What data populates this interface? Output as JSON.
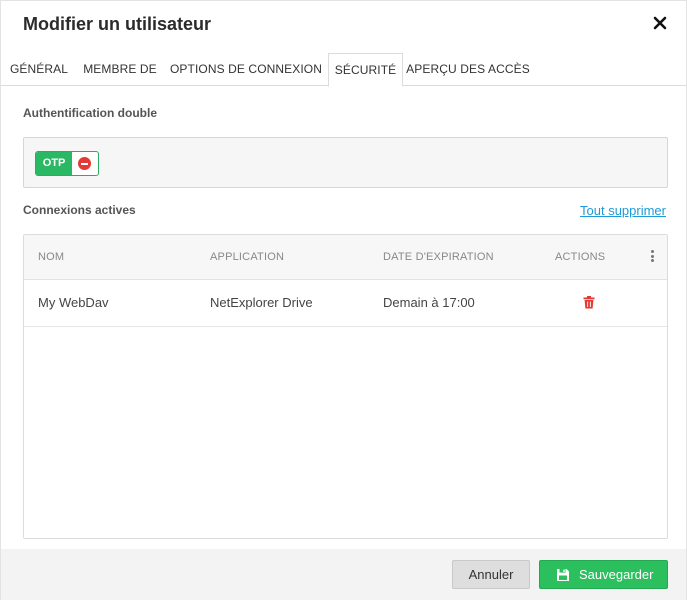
{
  "dialog": {
    "title": "Modifier un utilisateur"
  },
  "tabs": [
    {
      "label": "GÉNÉRAL"
    },
    {
      "label": "MEMBRE DE"
    },
    {
      "label": "OPTIONS DE CONNEXION"
    },
    {
      "label": "SÉCURITÉ",
      "active": true
    },
    {
      "label": "APERÇU DES ACCÈS"
    }
  ],
  "security": {
    "two_factor_label": "Authentification double",
    "otp_chip": "OTP",
    "active_connections_label": "Connexions actives",
    "delete_all_link": "Tout supprimer"
  },
  "table": {
    "headers": [
      "NOM",
      "APPLICATION",
      "DATE D'EXPIRATION",
      "ACTIONS"
    ],
    "rows": [
      {
        "name": "My WebDav",
        "application": "NetExplorer Drive",
        "expiration": "Demain à 17:00"
      }
    ]
  },
  "footer": {
    "cancel_label": "Annuler",
    "save_label": "Sauvegarder"
  },
  "colors": {
    "accent_green": "#2bbf5e",
    "danger_red": "#e53935",
    "link_blue": "#1e9bd7"
  }
}
